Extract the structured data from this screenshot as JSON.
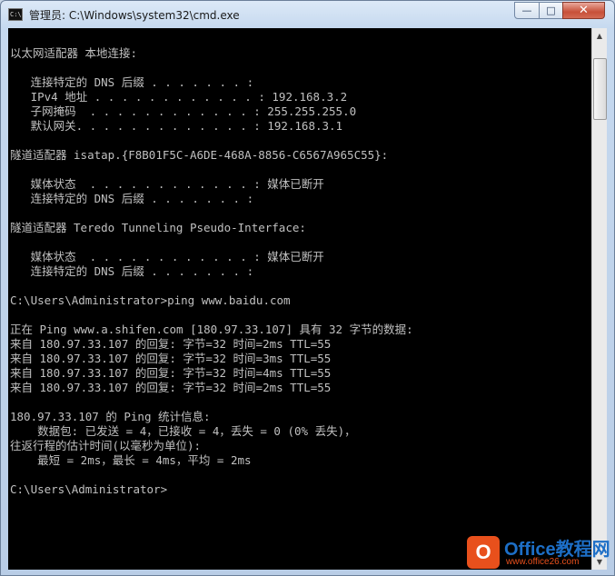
{
  "window": {
    "title": "管理员: C:\\Windows\\system32\\cmd.exe",
    "icon_text": "C:\\."
  },
  "controls": {
    "minimize": "—",
    "maximize": "□",
    "close": "✕"
  },
  "scrollbar": {
    "up": "▲",
    "down": "▼"
  },
  "console": {
    "lines": [
      "",
      "以太网适配器 本地连接:",
      "",
      "   连接特定的 DNS 后缀 . . . . . . . :",
      "   IPv4 地址 . . . . . . . . . . . . : 192.168.3.2",
      "   子网掩码  . . . . . . . . . . . . : 255.255.255.0",
      "   默认网关. . . . . . . . . . . . . : 192.168.3.1",
      "",
      "隧道适配器 isatap.{F8B01F5C-A6DE-468A-8856-C6567A965C55}:",
      "",
      "   媒体状态  . . . . . . . . . . . . : 媒体已断开",
      "   连接特定的 DNS 后缀 . . . . . . . :",
      "",
      "隧道适配器 Teredo Tunneling Pseudo-Interface:",
      "",
      "   媒体状态  . . . . . . . . . . . . : 媒体已断开",
      "   连接特定的 DNS 后缀 . . . . . . . :",
      "",
      "C:\\Users\\Administrator>ping www.baidu.com",
      "",
      "正在 Ping www.a.shifen.com [180.97.33.107] 具有 32 字节的数据:",
      "来自 180.97.33.107 的回复: 字节=32 时间=2ms TTL=55",
      "来自 180.97.33.107 的回复: 字节=32 时间=3ms TTL=55",
      "来自 180.97.33.107 的回复: 字节=32 时间=4ms TTL=55",
      "来自 180.97.33.107 的回复: 字节=32 时间=2ms TTL=55",
      "",
      "180.97.33.107 的 Ping 统计信息:",
      "    数据包: 已发送 = 4，已接收 = 4，丢失 = 0 (0% 丢失)，",
      "往返行程的估计时间(以毫秒为单位):",
      "    最短 = 2ms，最长 = 4ms，平均 = 2ms",
      "",
      "C:\\Users\\Administrator>"
    ]
  },
  "watermark": {
    "logo": "O",
    "name": "Office教程网",
    "url": "www.office26.com"
  }
}
